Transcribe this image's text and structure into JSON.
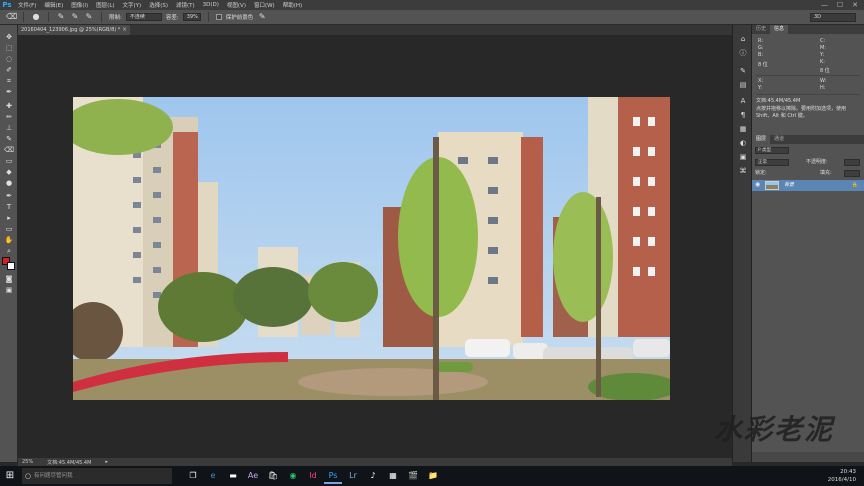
{
  "app": {
    "logo": "Ps"
  },
  "menu": {
    "items": [
      "文件(F)",
      "编辑(E)",
      "图像(I)",
      "图层(L)",
      "文字(Y)",
      "选择(S)",
      "滤镜(T)",
      "3D(D)",
      "视图(V)",
      "窗口(W)",
      "帮助(H)"
    ]
  },
  "window_controls": {
    "minimize": "—",
    "maximize": "☐",
    "close": "✕"
  },
  "options": {
    "feather_label": "限制:",
    "feather_value": "不连续",
    "tolerance_label": "容差:",
    "tolerance_value": "39%",
    "protect_label": "保护前景色",
    "workspace": "3D"
  },
  "document": {
    "tab_title": "20160404_123906.jpg @ 25%(RGB/8) *",
    "tab_close": "×"
  },
  "status": {
    "zoom": "25%",
    "doc_size": "文档:45.4M/45.4M",
    "arrow": "▸"
  },
  "right_panel": {
    "top_tabs": [
      "历史",
      "信息"
    ],
    "info": {
      "r": "R:",
      "g": "G:",
      "b": "B:",
      "c": "C:",
      "m": "M:",
      "y": "Y:",
      "k": "K:",
      "bit1": "8 位",
      "bit2": "8 位",
      "x": "X:",
      "y2": "Y:",
      "w": "W:",
      "h": "H:",
      "doc": "文档:45.4M/45.4M",
      "hint": "点按并拖移以擦除。要用附加选项，使用 Shift、Alt 和 Ctrl 键。"
    },
    "layers_tabs": [
      "图层",
      "通道"
    ],
    "layers": {
      "kind_label": "P 类型",
      "mode": "正常",
      "opacity_label": "不透明度:",
      "lock_label": "锁定:",
      "fill_label": "填充:",
      "layer_name": "背景",
      "lock_icon": "🔒"
    }
  },
  "taskbar": {
    "start": "⊞",
    "search_placeholder": "有问题尽管问我",
    "apps": [
      "e",
      "▬",
      "Ae",
      "🛍",
      "◉",
      "Id",
      "Ps",
      "Lr",
      "♪",
      "▦",
      "🎬",
      "📁"
    ],
    "time": "20:43",
    "date": "2016/4/10"
  },
  "watermark": "水彩老泥"
}
